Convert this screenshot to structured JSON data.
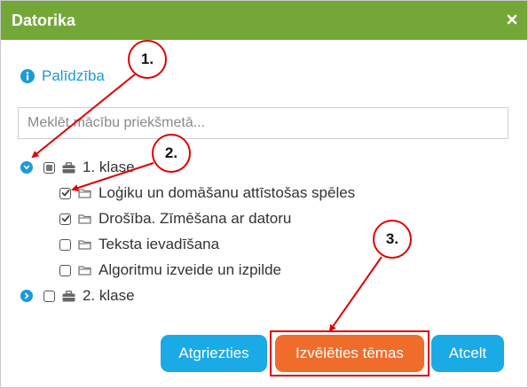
{
  "dialog": {
    "title": "Datorika",
    "close_glyph": "×"
  },
  "help": {
    "label": "Palīdzība",
    "icon": "info-icon"
  },
  "search": {
    "placeholder": "Meklēt mācību priekšmetā..."
  },
  "tree": {
    "classes": [
      {
        "label": "1. klase",
        "expanded": true,
        "state": "partial",
        "topics": [
          {
            "label": "Loģiku un domāšanu attīstošas spēles",
            "checked": true
          },
          {
            "label": "Drošība. Zīmēšana ar datoru",
            "checked": true
          },
          {
            "label": "Teksta ievadīšana",
            "checked": false
          },
          {
            "label": "Algoritmu izveide un izpilde",
            "checked": false
          }
        ]
      },
      {
        "label": "2. klase",
        "expanded": false,
        "state": "unchecked",
        "topics": []
      }
    ]
  },
  "buttons": {
    "back": "Atgriezties",
    "choose": "Izvēlēties tēmas",
    "cancel": "Atcelt"
  },
  "annotations": [
    "1.",
    "2.",
    "3."
  ],
  "colors": {
    "title_bar": "#73a839",
    "link": "#1a9bd7",
    "button_blue": "#1aaae5",
    "button_orange": "#f06c2b",
    "annotation_red": "#e00000"
  }
}
